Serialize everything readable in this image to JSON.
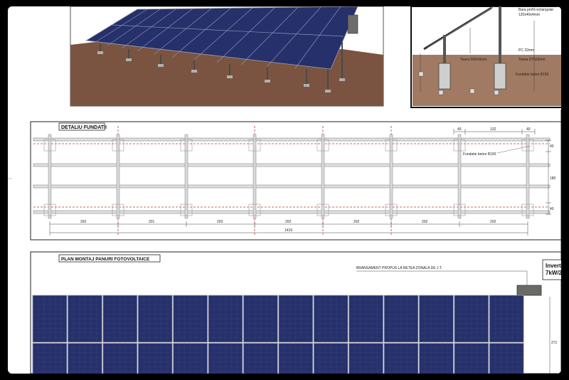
{
  "sections": {
    "foundation_detail": {
      "title": "DETALIU FUNDATII"
    },
    "panel_plan": {
      "title": "PLAN MONTAJ PANURI FOTOVOLTAICE"
    }
  },
  "foundation_dimensions": {
    "top_offset_left": "40",
    "top_span": "132",
    "top_offset_right": "40",
    "spans": [
      "202",
      "201",
      "203",
      "202",
      "202",
      "202",
      "202"
    ],
    "total": "1416",
    "right_side": [
      "40",
      "180",
      "40"
    ],
    "callout": "Fundatie beton B150"
  },
  "section_detail": {
    "labels": [
      "Bara profil rectangular",
      "120x40x4mm",
      "PC 22mm",
      "Teava D60x5mm",
      "Teava D75x5mm",
      "Fundatie beton B150"
    ]
  },
  "panel_plan_text": {
    "connection_note": "BRANSAMENT PROPUS LA RETEA ZONALA DE J.T.",
    "inverter_line1": "Invert",
    "inverter_line2": "7kW/2",
    "height_dim": "271"
  },
  "colors": {
    "panel": "#26306a",
    "panel_frame": "#9aa0b4",
    "soil": "#7a5440",
    "foundation_red": "#c0392b"
  }
}
